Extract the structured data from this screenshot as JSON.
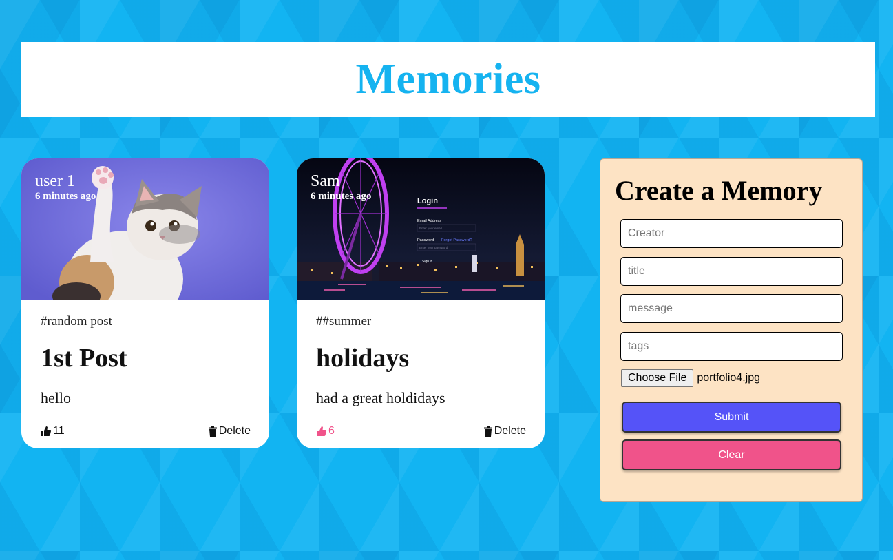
{
  "app": {
    "title": "Memories"
  },
  "posts": [
    {
      "creator": "user 1",
      "time": "6 minutes ago",
      "tags": "#random post",
      "title": "1st Post",
      "message": "hello",
      "likes": "11",
      "like_color": "#111111",
      "delete_label": "Delete",
      "image": "cat-photo"
    },
    {
      "creator": "Sam",
      "time": "6 minutes ago",
      "tags": "##summer",
      "title": "holidays",
      "message": "had a great holdidays",
      "likes": "6",
      "like_color": "#f0538a",
      "delete_label": "Delete",
      "image": "london-eye-login-screenshot",
      "image_text": {
        "login_title": "Login",
        "email_label": "Email Address",
        "email_placeholder": "Enter your email",
        "password_label": "Password",
        "forgot_link": "Forgot Password?",
        "password_placeholder": "Enter your password",
        "signin": "Sign in"
      }
    }
  ],
  "form": {
    "heading": "Create a Memory",
    "creator_placeholder": "Creator",
    "title_placeholder": "title",
    "message_placeholder": "message",
    "tags_placeholder": "tags",
    "file_button": "Choose File",
    "file_name": "portfolio4.jpg",
    "submit_label": "Submit",
    "clear_label": "Clear"
  },
  "colors": {
    "background": "#12b4f2",
    "title": "#15b3f0",
    "form_bg": "#fde3c4",
    "submit": "#5553f8",
    "clear": "#f0538a"
  }
}
